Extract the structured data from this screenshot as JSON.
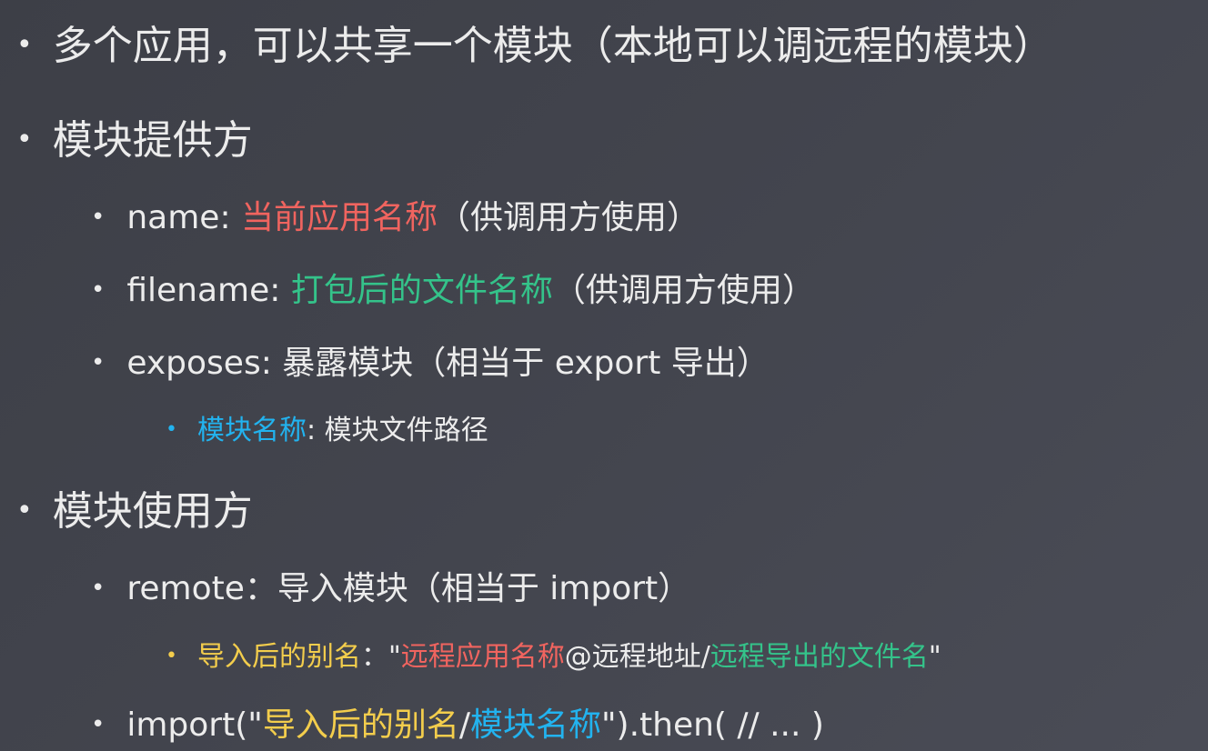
{
  "colors": {
    "background": "#42444d",
    "text": "#ececec",
    "red": "#f0645f",
    "green": "#34c38a",
    "blue": "#22b3ef",
    "yellow": "#f3cd4c"
  },
  "bullet_char": "•",
  "slide": {
    "line1": {
      "text": "多个应用，可以共享一个模块（本地可以调远程的模块）"
    },
    "provider": {
      "heading": "模块提供方"
    },
    "name_item": {
      "key": "name: ",
      "highlight": "当前应用名称",
      "suffix": "（供调用方使用）"
    },
    "filename_item": {
      "key": "filename: ",
      "highlight": "打包后的文件名称",
      "suffix": "（供调用方使用）"
    },
    "exposes_item": {
      "text": "exposes: 暴露模块（相当于 export 导出）"
    },
    "exposes_sub": {
      "key": "模块名称",
      "rest": ": 模块文件路径"
    },
    "consumer": {
      "heading": "模块使用方"
    },
    "remote_item": {
      "text": "remote：导入模块（相当于 import）"
    },
    "remote_sub": {
      "key": "导入后的别名",
      "colon_quote": "：\"",
      "app_name": "远程应用名称",
      "address": "@远程地址/",
      "exported_file": "远程导出的文件名",
      "close_quote": "\""
    },
    "import_item": {
      "prefix": "import(\"",
      "alias": "导入后的别名",
      "slash": "/",
      "module_name": "模块名称",
      "suffix": "\").then( // ... )"
    }
  }
}
